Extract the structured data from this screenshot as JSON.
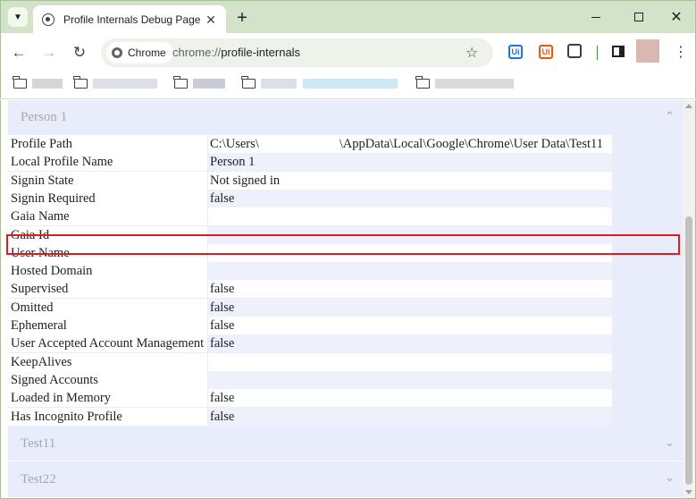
{
  "tab": {
    "title": "Profile Internals Debug Page",
    "close": "✕"
  },
  "window": {
    "new_tab": "+",
    "minimize": "",
    "maximize": "",
    "close": "✕"
  },
  "toolbar": {
    "back": "←",
    "forward": "→",
    "reload": "↻",
    "chip_label": "Chrome",
    "url_scheme": "chrome://",
    "url_host": "profile-internals",
    "star": "☆",
    "ext1": "Ui",
    "ext2": "Ui",
    "menu": "⋮"
  },
  "bookmarks": [
    {
      "name": "",
      "color": "#d6d6d6",
      "w": 34
    },
    {
      "name": "",
      "color": "#dcdfe6",
      "w": 72
    },
    {
      "name": "",
      "color": "#c9ccd6",
      "w": 36
    },
    {
      "name": "",
      "color": "#dcdfe6",
      "w": 40
    },
    {
      "name": "",
      "color": "#cfe6f3",
      "w": 106
    },
    {
      "name": "",
      "color": "#dadada",
      "w": 88
    }
  ],
  "profiles": [
    {
      "name": "Person 1",
      "expanded": true
    },
    {
      "name": "Test11",
      "expanded": false
    },
    {
      "name": "Test22",
      "expanded": false
    }
  ],
  "properties": [
    {
      "key": "Profile Path",
      "value_prefix": "C:\\Users\\",
      "value_suffix": "\\AppData\\Local\\Google\\Chrome\\User Data\\Test11",
      "redacted": true
    },
    {
      "key": "Local Profile Name",
      "value": "Person 1"
    },
    {
      "key": "Signin State",
      "value": "Not signed in"
    },
    {
      "key": "Signin Required",
      "value": "false"
    },
    {
      "key": "Gaia Name",
      "value": ""
    },
    {
      "key": "Gaia Id",
      "value": ""
    },
    {
      "key": "User Name",
      "value": ""
    },
    {
      "key": "Hosted Domain",
      "value": ""
    },
    {
      "key": "Supervised",
      "value": "false"
    },
    {
      "key": "Omitted",
      "value": "false"
    },
    {
      "key": "Ephemeral",
      "value": "false"
    },
    {
      "key": "User Accepted Account Management",
      "value": "false"
    },
    {
      "key": "KeepAlives",
      "value": ""
    },
    {
      "key": "Signed Accounts",
      "value": ""
    },
    {
      "key": "Loaded in Memory",
      "value": "false"
    },
    {
      "key": "Has Incognito Profile",
      "value": "false"
    }
  ]
}
